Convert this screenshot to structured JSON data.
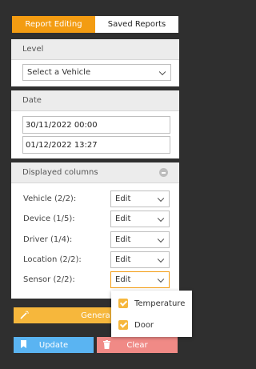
{
  "tabs": [
    {
      "label": "Report Editing",
      "active": true
    },
    {
      "label": "Saved Reports",
      "active": false
    }
  ],
  "level": {
    "heading": "Level",
    "select_value": "Select a Vehicle"
  },
  "date": {
    "heading": "Date",
    "from": "30/11/2022 00:00",
    "to": "01/12/2022 13:27"
  },
  "columns": {
    "heading": "Displayed columns",
    "rows": [
      {
        "label": "Vehicle (2/2):",
        "value": "Edit"
      },
      {
        "label": "Device (1/5):",
        "value": "Edit"
      },
      {
        "label": "Driver (1/4):",
        "value": "Edit"
      },
      {
        "label": "Location (2/2):",
        "value": "Edit"
      },
      {
        "label": "Sensor (2/2):",
        "value": "Edit"
      }
    ]
  },
  "sensor_dropdown": {
    "options": [
      {
        "label": "Temperature",
        "checked": true
      },
      {
        "label": "Door",
        "checked": true
      }
    ]
  },
  "buttons": {
    "generate_label": "Genera",
    "update_label": "Update",
    "clear_label": "Clear"
  },
  "colors": {
    "accent_orange": "#f39c12",
    "generate_yellow": "#f6b73c",
    "update_blue": "#5ab4f2",
    "clear_red": "#f08a86",
    "checkbox": "#f6b73c"
  }
}
